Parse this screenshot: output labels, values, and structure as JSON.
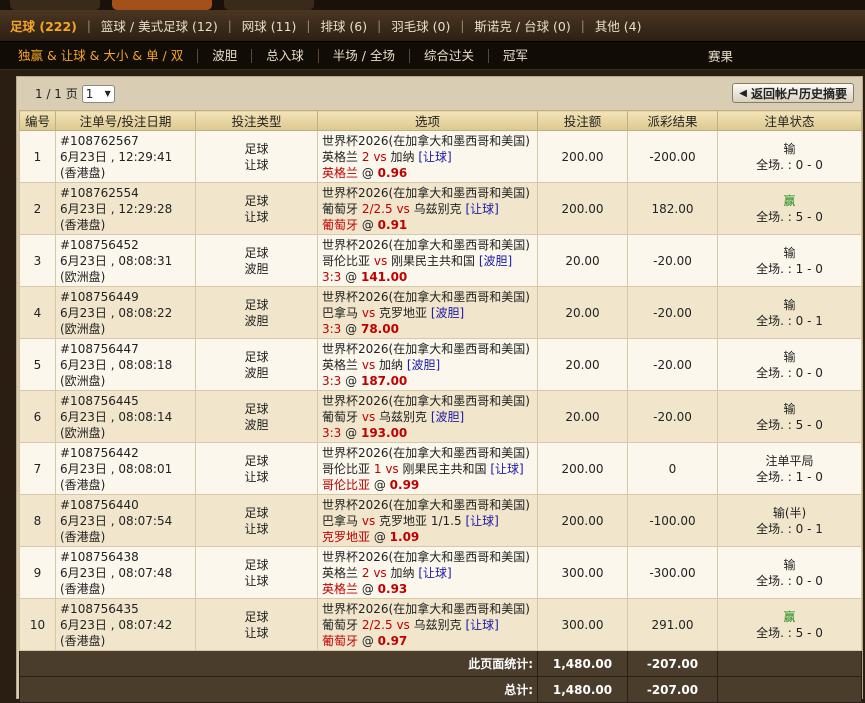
{
  "sports": [
    {
      "label": "足球 (222)",
      "active": true
    },
    {
      "label": "篮球 / 美式足球 (12)",
      "active": false
    },
    {
      "label": "网球 (11)",
      "active": false
    },
    {
      "label": "排球 (6)",
      "active": false
    },
    {
      "label": "羽毛球 (0)",
      "active": false
    },
    {
      "label": "斯诺克 / 台球 (0)",
      "active": false
    },
    {
      "label": "其他 (4)",
      "active": false
    }
  ],
  "bet_types": [
    {
      "label": "独赢 & 让球 & 大小 & 单 / 双",
      "active": true
    },
    {
      "label": "波胆",
      "active": false
    },
    {
      "label": "总入球",
      "active": false
    },
    {
      "label": "半场 / 全场",
      "active": false
    },
    {
      "label": "综合过关",
      "active": false
    },
    {
      "label": "冠军",
      "active": false
    }
  ],
  "results_label": "赛果",
  "pager": {
    "label": "1 / 1 页",
    "selected": "1",
    "back_label": "返回帐户历史摘要"
  },
  "columns": [
    "编号",
    "注单号/投注日期",
    "投注类型",
    "选项",
    "投注额",
    "派彩结果",
    "注单状态"
  ],
  "rows": [
    {
      "no": "1",
      "id": "#108762567",
      "date": "6月23日 , 12:29:41",
      "market": "(香港盘)",
      "sport": "足球",
      "type": "让球",
      "league": "世界杯2026(在加拿大和墨西哥和美国)",
      "home": "英格兰",
      "line": "2",
      "away": "加纳",
      "tag": "[让球]",
      "pick": "英格兰",
      "at": "@",
      "odds": "0.96",
      "stake": "200.00",
      "payout": "-200.00",
      "status": "输",
      "status_type": "lose",
      "score": "全场. : 0 - 0"
    },
    {
      "no": "2",
      "id": "#108762554",
      "date": "6月23日 , 12:29:28",
      "market": "(香港盘)",
      "sport": "足球",
      "type": "让球",
      "league": "世界杯2026(在加拿大和墨西哥和美国)",
      "home": "葡萄牙",
      "line": "2/2.5",
      "away": "乌兹别克",
      "tag": "[让球]",
      "pick": "葡萄牙",
      "at": "@",
      "odds": "0.91",
      "stake": "200.00",
      "payout": "182.00",
      "status": "赢",
      "status_type": "win",
      "score": "全场. : 5 - 0"
    },
    {
      "no": "3",
      "id": "#108756452",
      "date": "6月23日 , 08:08:31",
      "market": "(欧洲盘)",
      "sport": "足球",
      "type": "波胆",
      "league": "世界杯2026(在加拿大和墨西哥和美国)",
      "home": "哥伦比亚",
      "line": "",
      "away": "刚果民主共和国",
      "tag": "[波胆]",
      "pick": "3:3",
      "at": "@",
      "odds": "141.00",
      "stake": "20.00",
      "payout": "-20.00",
      "status": "输",
      "status_type": "lose",
      "score": "全场. : 1 - 0"
    },
    {
      "no": "4",
      "id": "#108756449",
      "date": "6月23日 , 08:08:22",
      "market": "(欧洲盘)",
      "sport": "足球",
      "type": "波胆",
      "league": "世界杯2026(在加拿大和墨西哥和美国)",
      "home": "巴拿马",
      "line": "",
      "away": "克罗地亚",
      "tag": "[波胆]",
      "pick": "3:3",
      "at": "@",
      "odds": "78.00",
      "stake": "20.00",
      "payout": "-20.00",
      "status": "输",
      "status_type": "lose",
      "score": "全场. : 0 - 1"
    },
    {
      "no": "5",
      "id": "#108756447",
      "date": "6月23日 , 08:08:18",
      "market": "(欧洲盘)",
      "sport": "足球",
      "type": "波胆",
      "league": "世界杯2026(在加拿大和墨西哥和美国)",
      "home": "英格兰",
      "line": "",
      "away": "加纳",
      "tag": "[波胆]",
      "pick": "3:3",
      "at": "@",
      "odds": "187.00",
      "stake": "20.00",
      "payout": "-20.00",
      "status": "输",
      "status_type": "lose",
      "score": "全场. : 0 - 0"
    },
    {
      "no": "6",
      "id": "#108756445",
      "date": "6月23日 , 08:08:14",
      "market": "(欧洲盘)",
      "sport": "足球",
      "type": "波胆",
      "league": "世界杯2026(在加拿大和墨西哥和美国)",
      "home": "葡萄牙",
      "line": "",
      "away": "乌兹别克",
      "tag": "[波胆]",
      "pick": "3:3",
      "at": "@",
      "odds": "193.00",
      "stake": "20.00",
      "payout": "-20.00",
      "status": "输",
      "status_type": "lose",
      "score": "全场. : 5 - 0"
    },
    {
      "no": "7",
      "id": "#108756442",
      "date": "6月23日 , 08:08:01",
      "market": "(香港盘)",
      "sport": "足球",
      "type": "让球",
      "league": "世界杯2026(在加拿大和墨西哥和美国)",
      "home": "哥伦比亚",
      "line": "1",
      "away": "刚果民主共和国",
      "tag": "[让球]",
      "pick": "哥伦比亚",
      "at": "@",
      "odds": "0.99",
      "stake": "200.00",
      "payout": "0",
      "status": "注单平局",
      "status_type": "lose",
      "score": "全场. : 1 - 0"
    },
    {
      "no": "8",
      "id": "#108756440",
      "date": "6月23日 , 08:07:54",
      "market": "(香港盘)",
      "sport": "足球",
      "type": "让球",
      "league": "世界杯2026(在加拿大和墨西哥和美国)",
      "home": "巴拿马",
      "line": "",
      "away": "克罗地亚 1/1.5",
      "tag": "[让球]",
      "pick": "克罗地亚",
      "at": "@",
      "odds": "1.09",
      "stake": "200.00",
      "payout": "-100.00",
      "status": "输(半)",
      "status_type": "lose",
      "score": "全场. : 0 - 1"
    },
    {
      "no": "9",
      "id": "#108756438",
      "date": "6月23日 , 08:07:48",
      "market": "(香港盘)",
      "sport": "足球",
      "type": "让球",
      "league": "世界杯2026(在加拿大和墨西哥和美国)",
      "home": "英格兰",
      "line": "2",
      "away": "加纳",
      "tag": "[让球]",
      "pick": "英格兰",
      "at": "@",
      "odds": "0.93",
      "stake": "300.00",
      "payout": "-300.00",
      "status": "输",
      "status_type": "lose",
      "score": "全场. : 0 - 0"
    },
    {
      "no": "10",
      "id": "#108756435",
      "date": "6月23日 , 08:07:42",
      "market": "(香港盘)",
      "sport": "足球",
      "type": "让球",
      "league": "世界杯2026(在加拿大和墨西哥和美国)",
      "home": "葡萄牙",
      "line": "2/2.5",
      "away": "乌兹别克",
      "tag": "[让球]",
      "pick": "葡萄牙",
      "at": "@",
      "odds": "0.97",
      "stake": "300.00",
      "payout": "291.00",
      "status": "赢",
      "status_type": "win",
      "score": "全场. : 5 - 0"
    }
  ],
  "totals": [
    {
      "label": "此页面统计:",
      "stake": "1,480.00",
      "payout": "-207.00"
    },
    {
      "label": "总计:",
      "stake": "1,480.00",
      "payout": "-207.00"
    }
  ]
}
